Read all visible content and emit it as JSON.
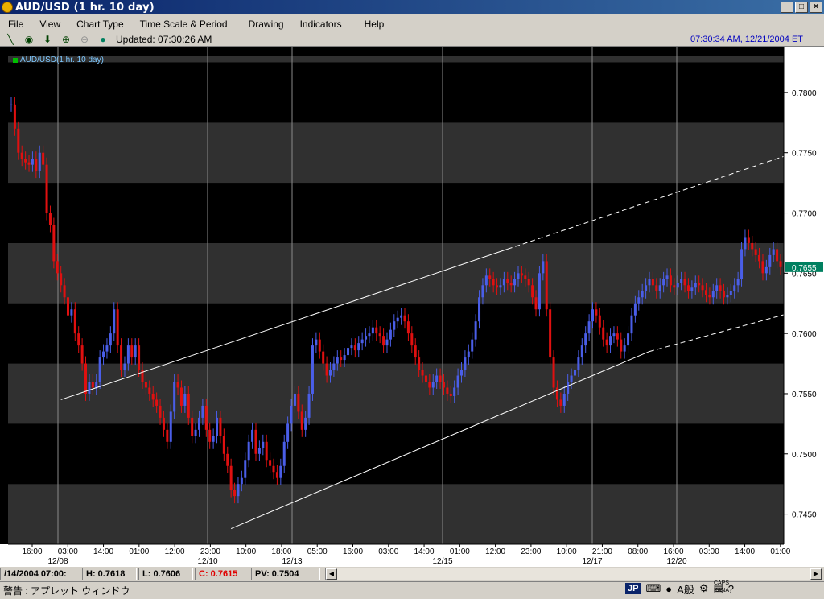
{
  "window": {
    "title": "AUD/USD (1 hr. 10 day)"
  },
  "menu": [
    "File",
    "View",
    "Chart Type",
    "Time Scale & Period",
    "Drawing",
    "Indicators",
    "Help"
  ],
  "toolbar": {
    "updated": "Updated: 07:30:26 AM",
    "clock": "07:30:34 AM, 12/21/2004 ET"
  },
  "legend": {
    "label": "AUD/USD(1 hr. 10 day)"
  },
  "chart_data": {
    "type": "candlestick",
    "ylim": [
      0.7425,
      0.783
    ],
    "yticks": [
      "0.7800",
      "0.7750",
      "0.7700",
      "0.7650",
      "0.7600",
      "0.7550",
      "0.7500",
      "0.7450"
    ],
    "ytick_values": [
      0.78,
      0.775,
      0.77,
      0.765,
      0.76,
      0.755,
      0.75,
      0.745
    ],
    "current_price": "0.7655",
    "current_value": 0.7655,
    "xticks_time": [
      "16:00",
      "03:00",
      "14:00",
      "01:00",
      "12:00",
      "23:00",
      "10:00",
      "18:00",
      "05:00",
      "16:00",
      "03:00",
      "14:00",
      "01:00",
      "12:00",
      "23:00",
      "10:00",
      "21:00",
      "08:00",
      "16:00",
      "03:00",
      "14:00",
      "01:00"
    ],
    "xticks_date": [
      "12/08",
      "12/10",
      "12/13",
      "12/15",
      "12/17",
      "12/20"
    ],
    "closes": [
      0.779,
      0.777,
      0.775,
      0.7745,
      0.7742,
      0.774,
      0.7745,
      0.7735,
      0.775,
      0.774,
      0.77,
      0.769,
      0.766,
      0.765,
      0.764,
      0.763,
      0.7615,
      0.762,
      0.76,
      0.759,
      0.7575,
      0.755,
      0.756,
      0.7555,
      0.756,
      0.758,
      0.7585,
      0.759,
      0.76,
      0.762,
      0.759,
      0.757,
      0.7575,
      0.759,
      0.758,
      0.759,
      0.757,
      0.756,
      0.7555,
      0.755,
      0.7545,
      0.754,
      0.753,
      0.752,
      0.751,
      0.7535,
      0.756,
      0.7555,
      0.754,
      0.755,
      0.753,
      0.7515,
      0.752,
      0.753,
      0.754,
      0.752,
      0.751,
      0.7515,
      0.753,
      0.7515,
      0.75,
      0.749,
      0.747,
      0.7465,
      0.7475,
      0.748,
      0.7495,
      0.751,
      0.752,
      0.75,
      0.7505,
      0.751,
      0.7495,
      0.749,
      0.7485,
      0.748,
      0.749,
      0.751,
      0.7525,
      0.754,
      0.755,
      0.7535,
      0.752,
      0.753,
      0.755,
      0.759,
      0.7595,
      0.7585,
      0.7575,
      0.7565,
      0.757,
      0.7575,
      0.758,
      0.7578,
      0.7582,
      0.7588,
      0.759,
      0.7586,
      0.7592,
      0.7595,
      0.7598,
      0.76,
      0.7605,
      0.76,
      0.7598,
      0.759,
      0.7595,
      0.7603,
      0.761,
      0.7613,
      0.7615,
      0.761,
      0.76,
      0.759,
      0.758,
      0.757,
      0.7565,
      0.756,
      0.7555,
      0.756,
      0.7565,
      0.756,
      0.7555,
      0.755,
      0.7548,
      0.7555,
      0.7565,
      0.757,
      0.758,
      0.7585,
      0.7595,
      0.761,
      0.763,
      0.764,
      0.7648,
      0.7645,
      0.764,
      0.7638,
      0.764,
      0.7645,
      0.7642,
      0.764,
      0.7645,
      0.765,
      0.7648,
      0.7645,
      0.764,
      0.763,
      0.762,
      0.765,
      0.766,
      0.762,
      0.758,
      0.7555,
      0.7545,
      0.754,
      0.755,
      0.756,
      0.7565,
      0.757,
      0.758,
      0.759,
      0.76,
      0.761,
      0.762,
      0.7615,
      0.7605,
      0.7595,
      0.759,
      0.7598,
      0.76,
      0.7595,
      0.7585,
      0.759,
      0.76,
      0.7615,
      0.7625,
      0.763,
      0.7635,
      0.764,
      0.7645,
      0.764,
      0.7635,
      0.764,
      0.7645,
      0.7648,
      0.764,
      0.7638,
      0.7642,
      0.7645,
      0.764,
      0.7635,
      0.7638,
      0.7642,
      0.764,
      0.7636,
      0.7632,
      0.763,
      0.7635,
      0.764,
      0.7635,
      0.763,
      0.7632,
      0.7635,
      0.764,
      0.7645,
      0.767,
      0.768,
      0.7675,
      0.767,
      0.7665,
      0.766,
      0.765,
      0.7655,
      0.7665,
      0.767,
      0.766,
      0.7655
    ],
    "trendlines": [
      {
        "style": "solid-then-dashed",
        "from": [
          14,
          0.7545
        ],
        "to_solid": [
          140,
          0.767
        ],
        "to_end": [
          221,
          0.775
        ]
      },
      {
        "style": "solid-then-dashed",
        "from": [
          62,
          0.7438
        ],
        "to_solid": [
          180,
          0.7585
        ],
        "to_end": [
          221,
          0.7618
        ]
      }
    ]
  },
  "status": {
    "date": "/14/2004 07:00:",
    "high": "H: 0.7618",
    "low": "L: 0.7606",
    "close": "C: 0.7615",
    "pv": "PV: 0.7504"
  },
  "applet": {
    "label": "警告 : アプレット ウィンドウ",
    "ime": "JP",
    "caps": "CAPS",
    "kana": "KANA"
  },
  "colors": {
    "up": "#4a5ee8",
    "down": "#e01010",
    "price_box": "#008060"
  }
}
